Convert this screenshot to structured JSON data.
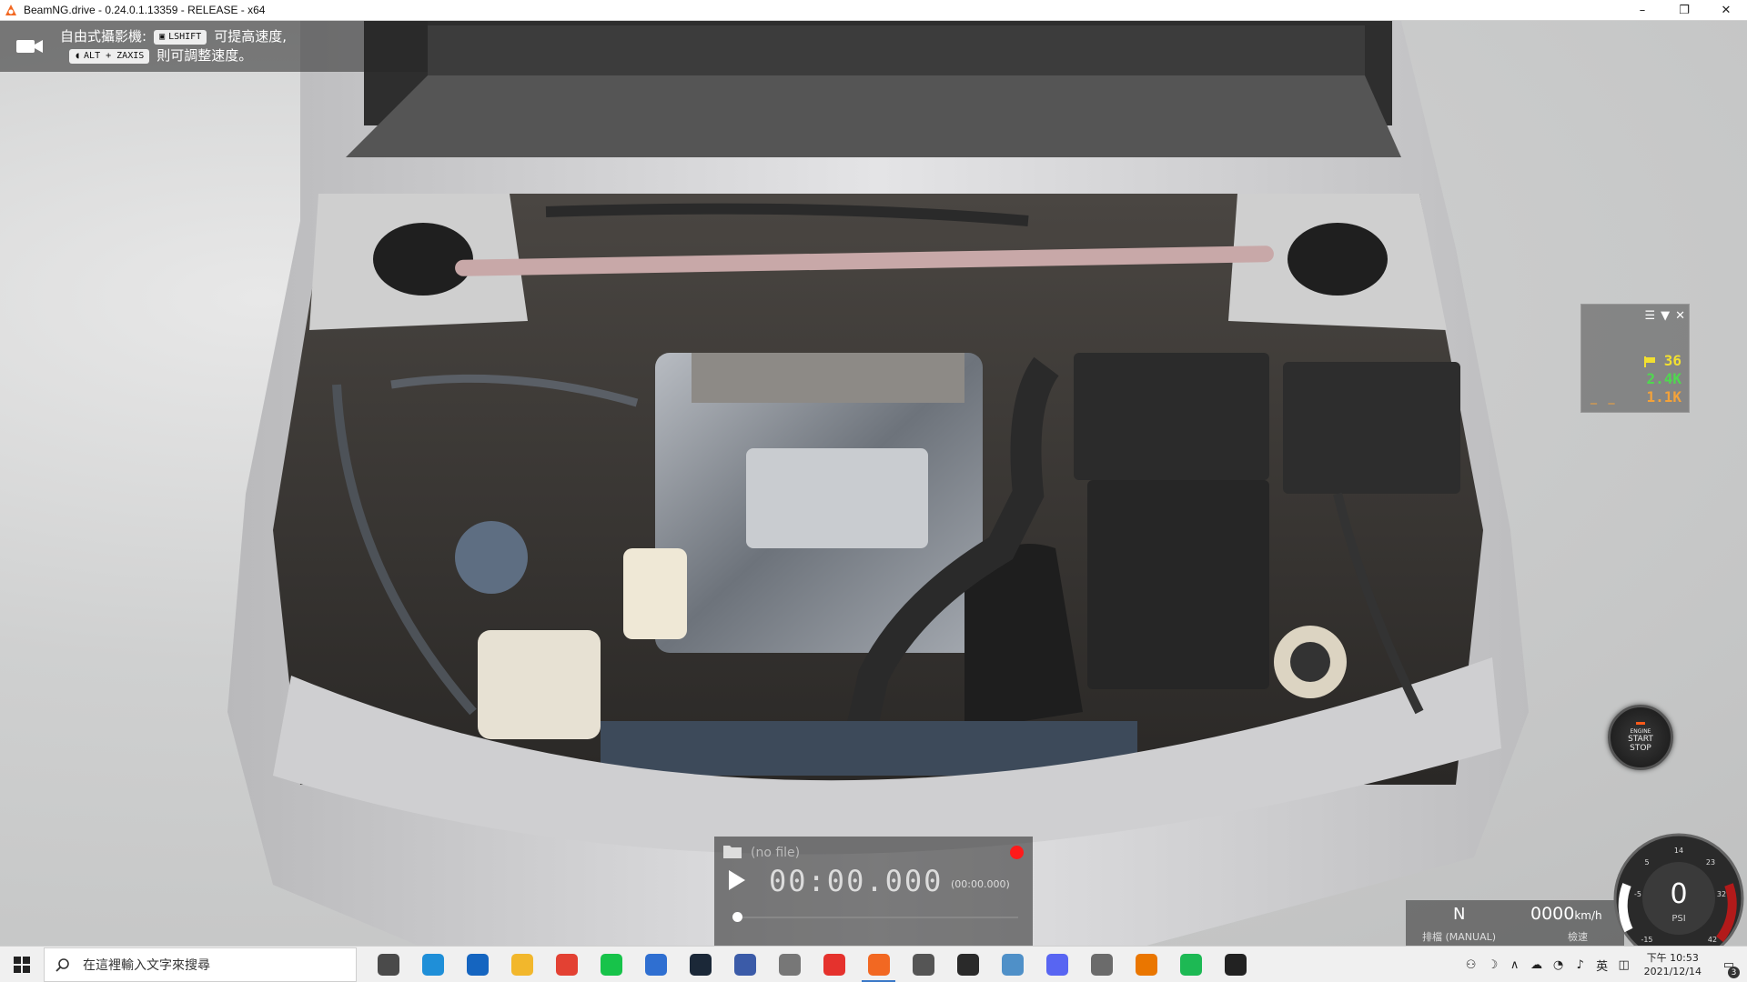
{
  "window": {
    "title": "BeamNG.drive - 0.24.0.1.13359 - RELEASE - x64",
    "minimize": "–",
    "maximize": "❐",
    "close": "✕"
  },
  "camera_hint": {
    "mode": "自由式攝影機:",
    "key1": "LSHIFT",
    "text1": "可提高速度,",
    "key2": "ALT + ZAXIS",
    "text2": "則可調整速度。"
  },
  "mini_app": {
    "value1": "36",
    "value2": "2.4K",
    "value3": "1.1K",
    "dashes": "_ _"
  },
  "engine_button": {
    "line1": "ENGINE",
    "line2": "START",
    "line3": "STOP"
  },
  "replay": {
    "file": "(no file)",
    "time": "00:00.000",
    "time_small": "(00:00.000)"
  },
  "speed_panel": {
    "gear": "N",
    "gear_label": "排檔 (MANUAL)",
    "speed": "0000",
    "speed_unit": "km/h",
    "speed_label": "檢速"
  },
  "boost_gauge": {
    "value": "0",
    "unit": "PSI",
    "ticks": [
      "-15",
      "-5",
      "5",
      "14",
      "23",
      "32",
      "42"
    ]
  },
  "taskbar": {
    "search_placeholder": "在這裡輸入文字來搜尋",
    "apps": [
      {
        "name": "task-view",
        "color": "#4a4a4a"
      },
      {
        "name": "edge",
        "color": "#1f8fd8"
      },
      {
        "name": "mail",
        "color": "#1565c0"
      },
      {
        "name": "file-explorer",
        "color": "#f2b72c"
      },
      {
        "name": "chrome",
        "color": "#e34133"
      },
      {
        "name": "line",
        "color": "#17c34a"
      },
      {
        "name": "store",
        "color": "#2f6fd1"
      },
      {
        "name": "steam",
        "color": "#1b2838"
      },
      {
        "name": "editor",
        "color": "#3b5ba8"
      },
      {
        "name": "tool",
        "color": "#777777"
      },
      {
        "name": "anydesk",
        "color": "#e5322d"
      },
      {
        "name": "beamng",
        "color": "#f26822"
      },
      {
        "name": "calculator",
        "color": "#555555"
      },
      {
        "name": "browser",
        "color": "#2a2a2a"
      },
      {
        "name": "monitor",
        "color": "#4f90c8"
      },
      {
        "name": "discord",
        "color": "#5865f2"
      },
      {
        "name": "photos",
        "color": "#6b6b6b"
      },
      {
        "name": "blender",
        "color": "#ea7600"
      },
      {
        "name": "spotify",
        "color": "#1db954"
      },
      {
        "name": "g-hub",
        "color": "#222222"
      }
    ],
    "active_app": "beamng",
    "tray": {
      "ime": "英",
      "time": "下午 10:53",
      "date": "2021/12/14",
      "notifications": "3"
    }
  }
}
